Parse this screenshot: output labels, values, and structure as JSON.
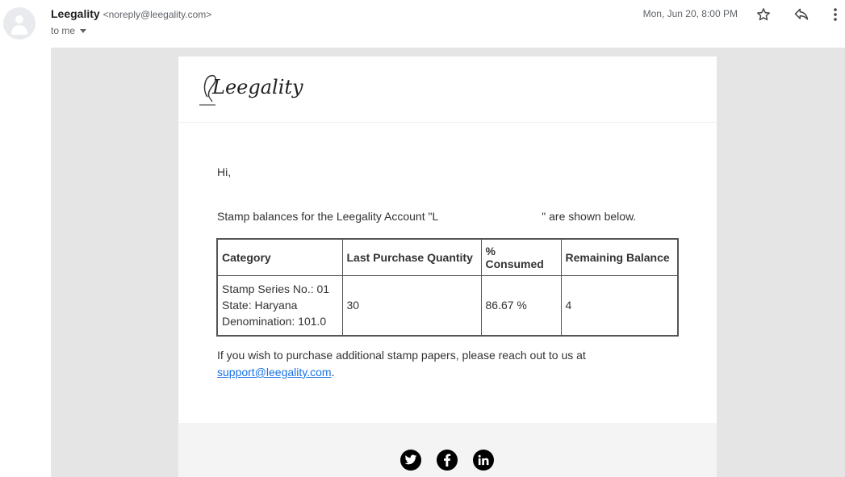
{
  "header": {
    "sender_name": "Leegality",
    "sender_email": "<noreply@leegality.com>",
    "recipient_label": "to me",
    "date": "Mon, Jun 20, 8:00 PM"
  },
  "email": {
    "logo_text": "Leegality",
    "greeting": "Hi,",
    "intro_prefix": "Stamp balances for the Leegality Account \"L",
    "intro_suffix": "\" are shown below.",
    "table": {
      "headers": [
        "Category",
        "Last Purchase Quantity",
        "% Consumed",
        "Remaining Balance"
      ],
      "row": {
        "category_line1": "Stamp Series No.: 01",
        "category_line2": "State: Haryana",
        "category_line3": "Denomination: 101.0",
        "quantity": "30",
        "consumed": "86.67 %",
        "remaining": "4"
      }
    },
    "outro_text": "If you wish to purchase additional stamp papers, please reach out to us at",
    "support_link": "support@leegality.com",
    "outro_end": "."
  },
  "footer": {
    "social_icons": [
      "twitter-icon",
      "facebook-icon",
      "linkedin-icon"
    ]
  }
}
